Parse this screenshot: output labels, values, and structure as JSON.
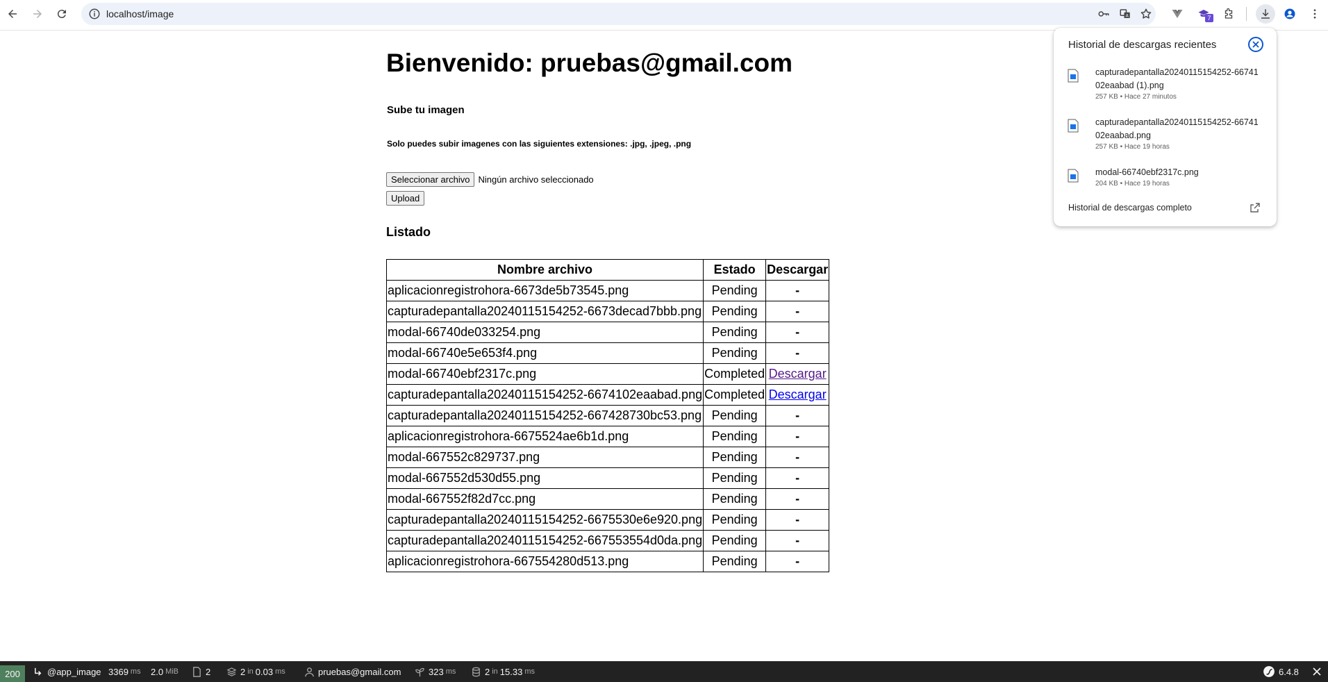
{
  "browser": {
    "url": "localhost/image",
    "extension_badge": "7"
  },
  "page": {
    "title": "Bienvenido: pruebas@gmail.com",
    "upload_heading": "Sube tu imagen",
    "note": "Solo puedes subir imagenes con las siguientes extensiones: .jpg, .jpeg, .png",
    "file_button": "Seleccionar archivo",
    "file_status": "Ningún archivo seleccionado",
    "upload_button": "Upload",
    "list_heading": "Listado",
    "table": {
      "headers": [
        "Nombre archivo",
        "Estado",
        "Descargar"
      ],
      "rows": [
        {
          "name": "aplicacionregistrohora-6673de5b73545.png",
          "status": "Pending",
          "download": "-"
        },
        {
          "name": "capturadepantalla20240115154252-6673decad7bbb.png",
          "status": "Pending",
          "download": "-"
        },
        {
          "name": "modal-66740de033254.png",
          "status": "Pending",
          "download": "-"
        },
        {
          "name": "modal-66740e5e653f4.png",
          "status": "Pending",
          "download": "-"
        },
        {
          "name": "modal-66740ebf2317c.png",
          "status": "Completed",
          "download": "Descargar"
        },
        {
          "name": "capturadepantalla20240115154252-6674102eaabad.png",
          "status": "Completed",
          "download": "Descargar"
        },
        {
          "name": "capturadepantalla20240115154252-667428730bc53.png",
          "status": "Pending",
          "download": "-"
        },
        {
          "name": "aplicacionregistrohora-6675524ae6b1d.png",
          "status": "Pending",
          "download": "-"
        },
        {
          "name": "modal-667552c829737.png",
          "status": "Pending",
          "download": "-"
        },
        {
          "name": "modal-667552d530d55.png",
          "status": "Pending",
          "download": "-"
        },
        {
          "name": "modal-667552f82d7cc.png",
          "status": "Pending",
          "download": "-"
        },
        {
          "name": "capturadepantalla20240115154252-6675530e6e920.png",
          "status": "Pending",
          "download": "-"
        },
        {
          "name": "capturadepantalla20240115154252-667553554d0da.png",
          "status": "Pending",
          "download": "-"
        },
        {
          "name": "aplicacionregistrohora-667554280d513.png",
          "status": "Pending",
          "download": "-"
        }
      ]
    }
  },
  "downloads": {
    "header": "Historial de descargas recientes",
    "items": [
      {
        "name": "capturadepantalla20240115154252-6674102eaabad (1).png",
        "meta": "257 KB • Hace 27 minutos"
      },
      {
        "name": "capturadepantalla20240115154252-6674102eaabad.png",
        "meta": "257 KB • Hace 19 horas"
      },
      {
        "name": "modal-66740ebf2317c.png",
        "meta": "204 KB • Hace 19 horas"
      }
    ],
    "footer": "Historial de descargas completo"
  },
  "debug_bar": {
    "status_code": "200",
    "route": "@app_image",
    "time_value": "3369",
    "time_unit": "ms",
    "memory_value": "2.0",
    "memory_unit": "MiB",
    "requests": "2",
    "cache_value": "2",
    "cache_in": "in",
    "cache_time": "0.03",
    "cache_unit": "ms",
    "user": "pruebas@gmail.com",
    "twig_value": "323",
    "twig_unit": "ms",
    "db_value": "2",
    "db_in": "in",
    "db_time": "15.33",
    "db_unit": "ms",
    "version": "6.4.8"
  },
  "colors": {
    "accent": "#0b57d0",
    "visited_link": "#551a8b",
    "link": "#0000ee",
    "status_ok": "#4f805d",
    "debug_bar_bg": "#222222"
  }
}
